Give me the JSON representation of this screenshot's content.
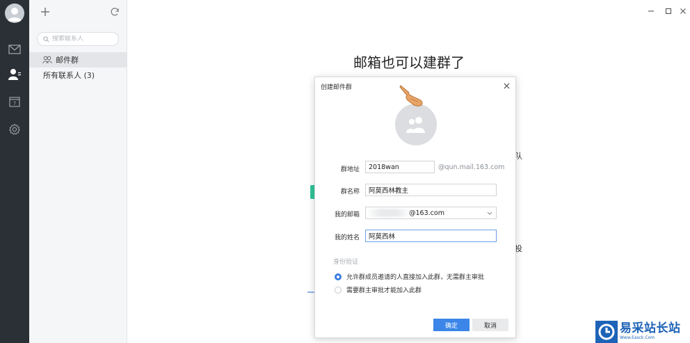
{
  "sidebar_panel": {
    "search_placeholder": "搜索联系人",
    "items": [
      {
        "label": "邮件群",
        "active": true
      },
      {
        "label": "所有联系人 (3)",
        "active": false
      }
    ]
  },
  "main": {
    "title": "邮箱也可以建群了",
    "peek_1": "队",
    "peek_2": "投"
  },
  "dialog": {
    "title": "创建邮件群",
    "fields": {
      "address_label": "群地址",
      "address_value": "2018wan",
      "address_suffix": "@qun.mail.163.com",
      "name_label": "群名称",
      "name_value": "阿莫西林教主",
      "email_label": "我的邮箱",
      "email_value": "@163.com",
      "myname_label": "我的姓名",
      "myname_value": "阿莫西林"
    },
    "verify_label": "身份验证",
    "options": [
      {
        "label": "允许群成员邀请的人直接加入此群，无需群主审批",
        "checked": true
      },
      {
        "label": "需要群主审批才能加入此群",
        "checked": false
      }
    ],
    "confirm_label": "确定",
    "cancel_label": "取消"
  },
  "watermark": {
    "cn": "易采站长站",
    "en": "Www.Easck.Com"
  },
  "colors": {
    "rail": "#2b3036",
    "accent": "#3b86e8",
    "green": "#2fc39a"
  }
}
